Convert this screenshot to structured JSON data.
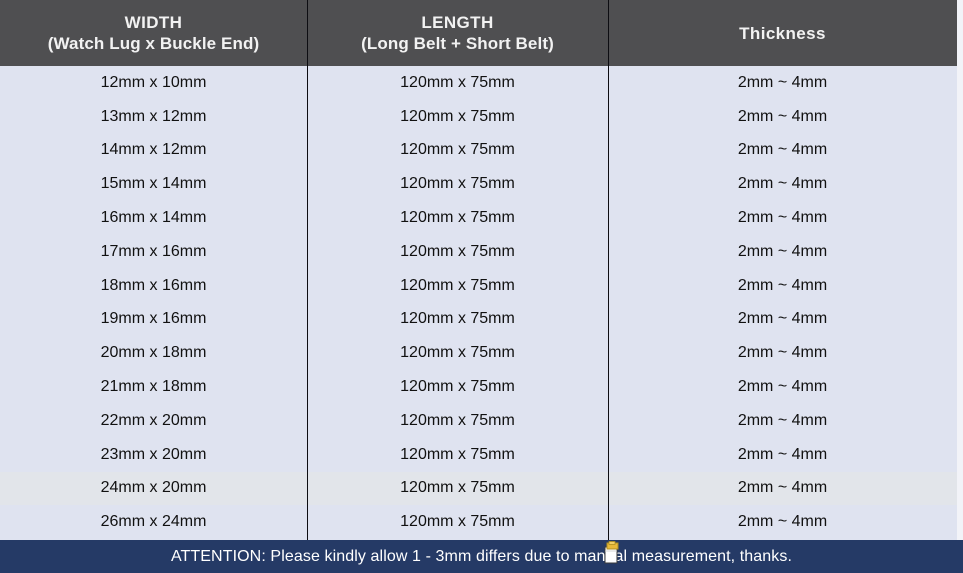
{
  "table": {
    "headers": [
      {
        "main": "WIDTH",
        "sub": "(Watch Lug x Buckle End)"
      },
      {
        "main": "LENGTH",
        "sub": "(Long Belt + Short Belt)"
      },
      {
        "main": "Thickness",
        "sub": ""
      }
    ],
    "rows": [
      {
        "width": "12mm x 10mm",
        "length": "120mm x 75mm",
        "thickness": "2mm ~ 4mm",
        "highlighted": false
      },
      {
        "width": "13mm x 12mm",
        "length": "120mm x 75mm",
        "thickness": "2mm ~ 4mm",
        "highlighted": false
      },
      {
        "width": "14mm x 12mm",
        "length": "120mm x 75mm",
        "thickness": "2mm ~ 4mm",
        "highlighted": false
      },
      {
        "width": "15mm x 14mm",
        "length": "120mm x 75mm",
        "thickness": "2mm ~ 4mm",
        "highlighted": false
      },
      {
        "width": "16mm x 14mm",
        "length": "120mm x 75mm",
        "thickness": "2mm ~ 4mm",
        "highlighted": false
      },
      {
        "width": "17mm x 16mm",
        "length": "120mm x 75mm",
        "thickness": "2mm ~ 4mm",
        "highlighted": false
      },
      {
        "width": "18mm x 16mm",
        "length": "120mm x 75mm",
        "thickness": "2mm ~ 4mm",
        "highlighted": false
      },
      {
        "width": "19mm x 16mm",
        "length": "120mm x 75mm",
        "thickness": "2mm ~ 4mm",
        "highlighted": false
      },
      {
        "width": "20mm x 18mm",
        "length": "120mm x 75mm",
        "thickness": "2mm ~ 4mm",
        "highlighted": false
      },
      {
        "width": "21mm x 18mm",
        "length": "120mm x 75mm",
        "thickness": "2mm ~ 4mm",
        "highlighted": false
      },
      {
        "width": "22mm x 20mm",
        "length": "120mm x 75mm",
        "thickness": "2mm ~ 4mm",
        "highlighted": false
      },
      {
        "width": "23mm x 20mm",
        "length": "120mm x 75mm",
        "thickness": "2mm ~ 4mm",
        "highlighted": false
      },
      {
        "width": "24mm x 20mm",
        "length": "120mm x 75mm",
        "thickness": "2mm ~ 4mm",
        "highlighted": true
      },
      {
        "width": "26mm x 24mm",
        "length": "120mm x 75mm",
        "thickness": "2mm ~ 4mm",
        "highlighted": false
      }
    ]
  },
  "footer": {
    "attention_text": "ATTENTION: Please kindly allow 1 - 3mm differs due to manual measurement, thanks."
  },
  "icons": {
    "cursor": "drag-copy-cursor-icon"
  },
  "colors": {
    "header_background": "#4f4f51",
    "header_text": "#f2f2f2",
    "body_background": "#dfe3f0",
    "row_highlight": "#e2e5ea",
    "body_text": "#111111",
    "footer_background": "#253a66",
    "footer_text": "#ffffff",
    "divider": "#0d0d12"
  }
}
